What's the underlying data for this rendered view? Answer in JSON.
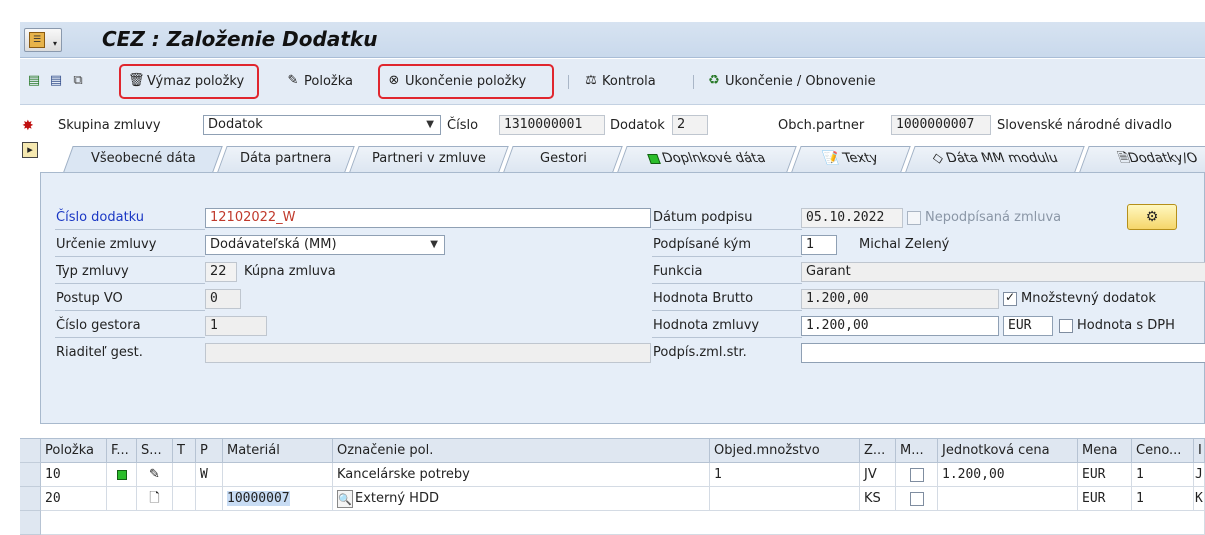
{
  "window": {
    "title": "CEZ : Založenie Dodatku"
  },
  "toolbar": {
    "delete_item": "Výmaz položky",
    "item": "Položka",
    "close_item": "Ukončenie položky",
    "check": "Kontrola",
    "close_renew": "Ukončenie / Obnovenie"
  },
  "header": {
    "group_label": "Skupina zmluvy",
    "group_value": "Dodatok",
    "number_label": "Číslo",
    "number_value": "1310000001",
    "amendment_label": "Dodatok",
    "amendment_value": "2",
    "partner_label": "Obch.partner",
    "partner_id": "1000000007",
    "partner_name": "Slovenské národné divadlo"
  },
  "tabs": [
    {
      "label": "Všeobecné dáta",
      "active": true
    },
    {
      "label": "Dáta partnera"
    },
    {
      "label": "Partneri v zmluve"
    },
    {
      "label": "Gestori"
    },
    {
      "label": "Doplnkové dáta"
    },
    {
      "label": "Texty"
    },
    {
      "label": "Dáta MM modulu"
    },
    {
      "label": "Dodatky/O"
    }
  ],
  "form": {
    "amend_no_label": "Číslo dodatku",
    "amend_no_value": "12102022_W",
    "purpose_label": "Určenie zmluvy",
    "purpose_value": "Dodávateľská (MM)",
    "type_label": "Typ zmluvy",
    "type_code": "22",
    "type_text": "Kúpna zmluva",
    "procedure_label": "Postup VO",
    "procedure_value": "0",
    "gestor_label": "Číslo gestora",
    "gestor_value": "1",
    "director_label": "Riaditeľ gest.",
    "sign_date_label": "Dátum podpisu",
    "sign_date_value": "05.10.2022",
    "unsigned_label": "Nepodpísaná zmluva",
    "signed_by_label": "Podpísané kým",
    "signed_by_code": "1",
    "signed_by_name": "Michal Zelený",
    "function_label": "Funkcia",
    "function_value": "Garant",
    "gross_label": "Hodnota Brutto",
    "gross_value": "1.200,00",
    "qty_amend_label": "Množstevný dodatok",
    "contract_value_label": "Hodnota zmluvy",
    "contract_value": "1.200,00",
    "currency": "EUR",
    "vat_label": "Hodnota s DPH",
    "signer_other_label": "Podpís.zml.str."
  },
  "table": {
    "headers": [
      "Položka",
      "F...",
      "S...",
      "T",
      "P",
      "Materiál",
      "Označenie pol.",
      "Objed.množstvo",
      "Z...",
      "M...",
      "Jednotková cena",
      "Mena",
      "Ceno...",
      "I"
    ],
    "rows": [
      {
        "item": "10",
        "p": "W",
        "material": "",
        "desc": "Kancelárske potreby",
        "qty": "1",
        "unit": "JV",
        "price": "1.200,00",
        "currency": "EUR",
        "per": "1",
        "extra": "J"
      },
      {
        "item": "20",
        "p": "",
        "material": "10000007",
        "desc": "Externý HDD",
        "qty": "",
        "unit": "KS",
        "price": "",
        "currency": "EUR",
        "per": "1",
        "extra": "K"
      }
    ]
  }
}
